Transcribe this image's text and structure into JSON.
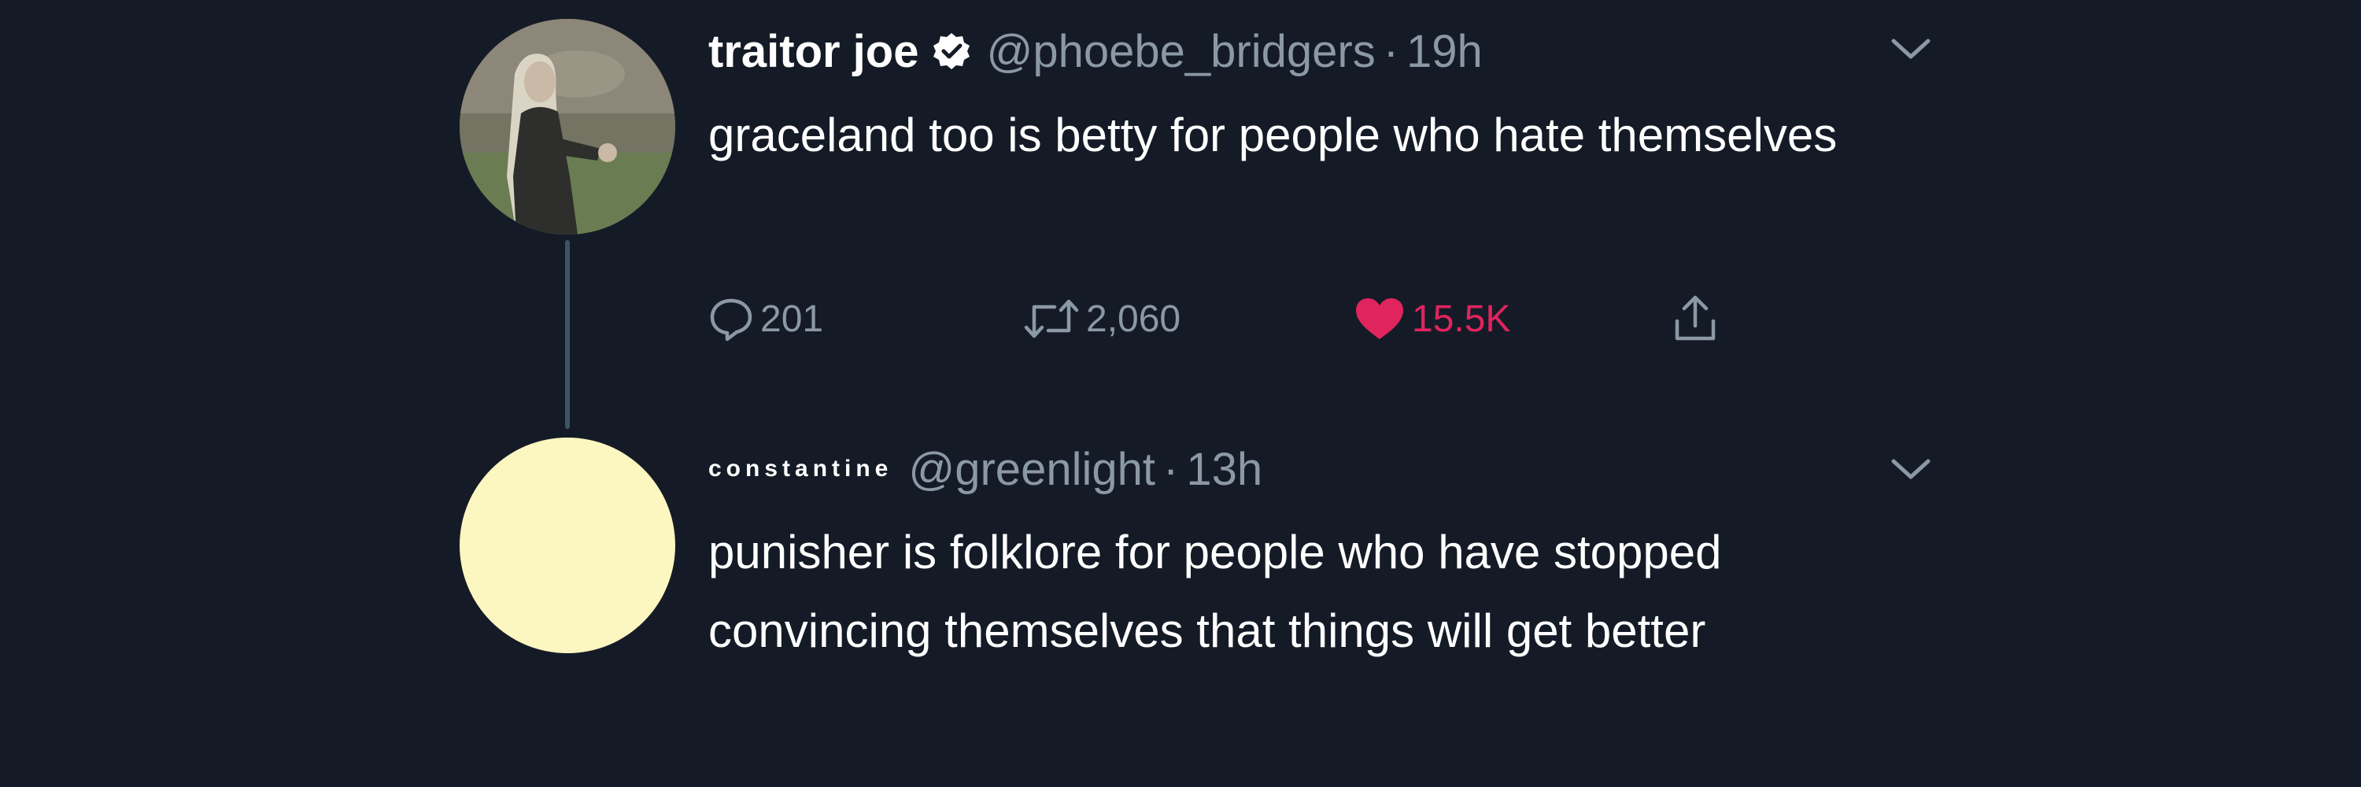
{
  "colors": {
    "background": "#151b26",
    "text_primary": "#ffffff",
    "text_secondary": "#8b98a5",
    "like_active": "#e0245e",
    "thread_line": "#3d5466",
    "avatar_2_fill": "#fcf6c1"
  },
  "tweets": [
    {
      "display_name": "traitor joe",
      "verified": true,
      "verified_icon": "verified-badge-icon",
      "handle": "@phoebe_bridgers",
      "separator": "·",
      "time": "19h",
      "text": "graceland too is betty for people who hate themselves",
      "actions": {
        "reply_icon": "reply-icon",
        "reply_count": "201",
        "retweet_icon": "retweet-icon",
        "retweet_count": "2,060",
        "like_icon": "heart-filled-icon",
        "like_count": "15.5K",
        "liked": true,
        "share_icon": "share-icon"
      },
      "menu_icon": "chevron-down-icon"
    },
    {
      "display_name": "constantine",
      "verified": false,
      "handle": "@greenlight",
      "separator": "·",
      "time": "13h",
      "text": "punisher is folklore for people who have stopped convincing themselves that things will get better",
      "menu_icon": "chevron-down-icon"
    }
  ]
}
